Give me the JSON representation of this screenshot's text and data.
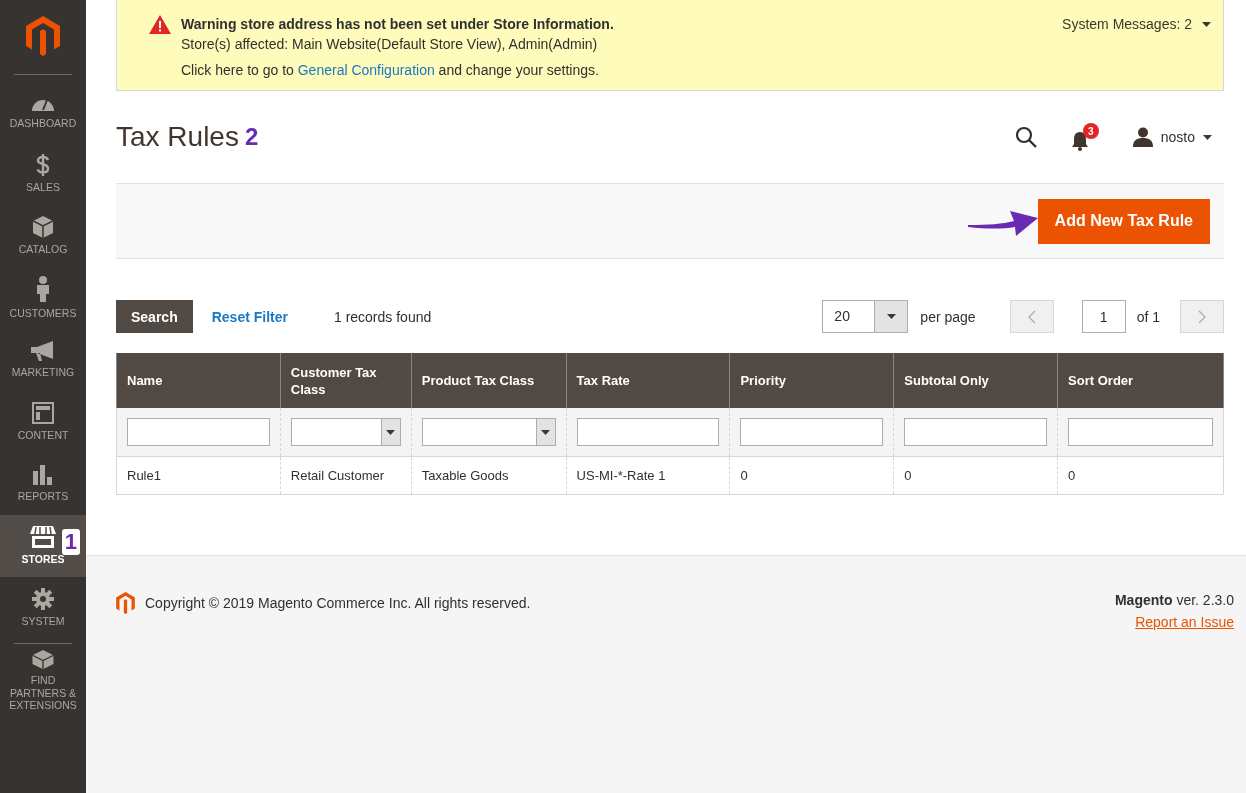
{
  "sidebar": {
    "items": [
      {
        "label": "DASHBOARD",
        "selected": false
      },
      {
        "label": "SALES",
        "selected": false
      },
      {
        "label": "CATALOG",
        "selected": false
      },
      {
        "label": "CUSTOMERS",
        "selected": false
      },
      {
        "label": "MARKETING",
        "selected": false
      },
      {
        "label": "CONTENT",
        "selected": false
      },
      {
        "label": "REPORTS",
        "selected": false
      },
      {
        "label": "STORES",
        "selected": true,
        "annotation": "1"
      },
      {
        "label": "SYSTEM",
        "selected": false
      },
      {
        "label": "FIND PARTNERS & EXTENSIONS",
        "selected": false
      }
    ]
  },
  "system_message": {
    "title": "Warning store address has not been set under Store Information.",
    "affected": "Store(s) affected: Main Website(Default Store View), Admin(Admin)",
    "text_before": "Click here to go to",
    "link": "General Configuration",
    "text_after": "and change your settings.",
    "counter": "System Messages: 2"
  },
  "header": {
    "title": "Tax Rules",
    "annotation": "2",
    "notifications": "3",
    "user": "nosto"
  },
  "actions": {
    "primary_button": "Add New Tax Rule"
  },
  "grid_controls": {
    "search_button": "Search",
    "reset_link": "Reset Filter",
    "records": "1 records found",
    "per_page_value": "20",
    "per_page_label": "per page",
    "page": "1",
    "page_total": "of 1"
  },
  "table": {
    "columns": [
      {
        "label": "Name",
        "kind": "text"
      },
      {
        "label": "Customer Tax Class",
        "kind": "select"
      },
      {
        "label": "Product Tax Class",
        "kind": "select"
      },
      {
        "label": "Tax Rate",
        "kind": "text"
      },
      {
        "label": "Priority",
        "kind": "text"
      },
      {
        "label": "Subtotal Only",
        "kind": "text"
      },
      {
        "label": "Sort Order",
        "kind": "text"
      }
    ],
    "rows": [
      [
        "Rule1",
        "Retail Customer",
        "Taxable Goods",
        "US-MI-*-Rate 1",
        "0",
        "0",
        "0"
      ]
    ]
  },
  "footer": {
    "copyright": "Copyright © 2019 Magento Commerce Inc. All rights reserved.",
    "version": "**Magento** ver. 2.3.0",
    "report_link": "Report an Issue"
  }
}
